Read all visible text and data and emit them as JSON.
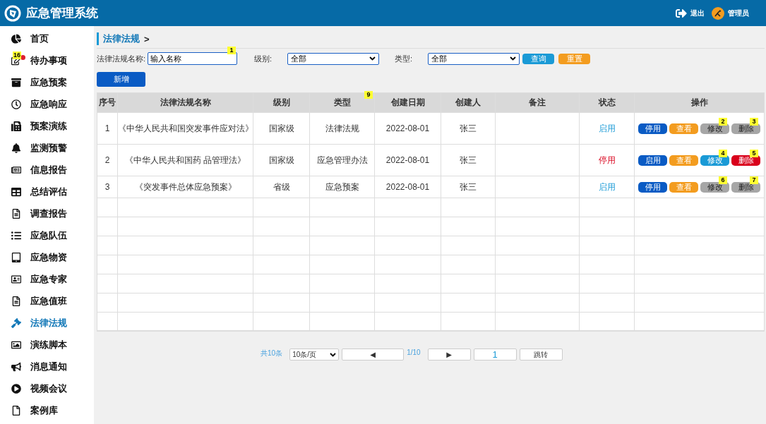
{
  "app": {
    "title": "应急管理系统",
    "logout": "退出",
    "user": "管理员"
  },
  "sidebar": {
    "items": [
      {
        "label": "首页",
        "selected": false
      },
      {
        "label": "待办事项",
        "selected": false,
        "marker": "16",
        "alert": true
      },
      {
        "label": "应急预案",
        "selected": false
      },
      {
        "label": "应急响应",
        "selected": false
      },
      {
        "label": "预案演练",
        "selected": false
      },
      {
        "label": "监测预警",
        "selected": false
      },
      {
        "label": "信息报告",
        "selected": false
      },
      {
        "label": "总结评估",
        "selected": false
      },
      {
        "label": "调查报告",
        "selected": false
      },
      {
        "label": "应急队伍",
        "selected": false
      },
      {
        "label": "应急物资",
        "selected": false
      },
      {
        "label": "应急专家",
        "selected": false
      },
      {
        "label": "应急值班",
        "selected": false
      },
      {
        "label": "法律法规",
        "selected": true
      },
      {
        "label": "演练脚本",
        "selected": false
      },
      {
        "label": "消息通知",
        "selected": false
      },
      {
        "label": "视频会议",
        "selected": false
      },
      {
        "label": "案例库",
        "selected": false
      }
    ]
  },
  "breadcrumb": {
    "title": "法律法规",
    "separator": ">"
  },
  "filters": {
    "name_label": "法律法规名称:",
    "name_value": "输入名称",
    "name_marker": "1",
    "level_label": "级别:",
    "level_value": "全部",
    "type_label": "类型:",
    "type_value": "全部",
    "search_button": "查询",
    "reset_button": "重置"
  },
  "add_button": "新增",
  "table": {
    "columns": [
      {
        "label": "序号"
      },
      {
        "label": "法律法规名称"
      },
      {
        "label": "级别"
      },
      {
        "label": "类型",
        "marker": "9"
      },
      {
        "label": "创建日期"
      },
      {
        "label": "创建人"
      },
      {
        "label": "备注"
      },
      {
        "label": "状态"
      },
      {
        "label": "操作"
      }
    ],
    "rows": [
      {
        "index": "1",
        "name": "《中华人民共和国突发事件应对法》",
        "level": "国家级",
        "type": "法律法规",
        "date": "2022-08-01",
        "creator": "张三",
        "status": "启用",
        "enabled": true,
        "actions": [
          {
            "kind": "toggle",
            "label": "停用"
          },
          {
            "kind": "view",
            "label": "查看"
          },
          {
            "kind": "edit",
            "label": "修改",
            "active": false,
            "marker": "2"
          },
          {
            "kind": "delete",
            "label": "删除",
            "active": false,
            "marker": "3"
          }
        ]
      },
      {
        "index": "2",
        "name": "《中华人民共和国药 品管理法》",
        "level": "国家级",
        "type": "应急管理办法",
        "date": "2022-08-01",
        "creator": "张三",
        "status": "停用",
        "enabled": false,
        "actions": [
          {
            "kind": "toggle",
            "label": "启用"
          },
          {
            "kind": "view",
            "label": "查看"
          },
          {
            "kind": "edit",
            "label": "修改",
            "active": true,
            "marker": "4"
          },
          {
            "kind": "delete",
            "label": "删除",
            "active": true,
            "marker": "5"
          }
        ]
      },
      {
        "index": "3",
        "name": "《突发事件总体应急预案》",
        "level": "省级",
        "type": "应急预案",
        "date": "2022-08-01",
        "creator": "张三",
        "status": "启用",
        "enabled": true,
        "actions": [
          {
            "kind": "toggle",
            "label": "停用"
          },
          {
            "kind": "view",
            "label": "查看"
          },
          {
            "kind": "edit",
            "label": "修改",
            "active": false,
            "marker": "6"
          },
          {
            "kind": "delete",
            "label": "删除",
            "active": false,
            "marker": "7"
          }
        ]
      }
    ]
  },
  "pagination": {
    "total": "共10条",
    "page_size": "10条/页",
    "prev": "◀",
    "page_info": "1/10",
    "next": "▶",
    "page_value": "1",
    "jump": "跳转"
  }
}
